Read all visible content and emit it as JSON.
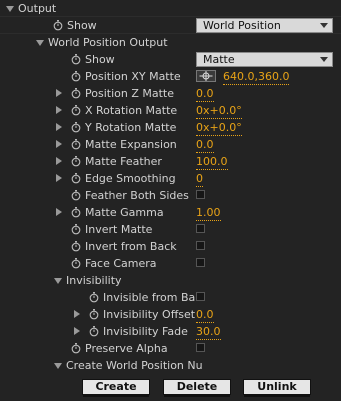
{
  "rows": [
    {
      "label": "Output",
      "tw": "open",
      "indent": 6,
      "sep": true
    },
    {
      "label": "Show",
      "sw": true,
      "indent": 52,
      "control": {
        "type": "dropdown",
        "value": "World Position"
      },
      "sep": true
    },
    {
      "label": "World Position Output",
      "tw": "open",
      "indent": 36
    },
    {
      "label": "Show",
      "sw": true,
      "indent": 70,
      "control": {
        "type": "dropdown",
        "value": "Matte"
      }
    },
    {
      "label": "Position XY Matte",
      "sw": true,
      "indent": 70,
      "control": {
        "type": "target",
        "value": "640.0,360.0"
      }
    },
    {
      "label": "Position Z Matte",
      "sw": true,
      "tw": "closed",
      "indent": 56,
      "control": {
        "type": "value",
        "value": "0.0"
      }
    },
    {
      "label": "X Rotation Matte",
      "sw": true,
      "tw": "closed",
      "indent": 56,
      "control": {
        "type": "value",
        "value": "0x+0.0°"
      }
    },
    {
      "label": "Y Rotation Matte",
      "sw": true,
      "tw": "closed",
      "indent": 56,
      "control": {
        "type": "value",
        "value": "0x+0.0°"
      }
    },
    {
      "label": "Matte Expansion",
      "sw": true,
      "tw": "closed",
      "indent": 56,
      "control": {
        "type": "value",
        "value": "0.0"
      }
    },
    {
      "label": "Matte Feather",
      "sw": true,
      "tw": "closed",
      "indent": 56,
      "control": {
        "type": "value",
        "value": "100.0"
      }
    },
    {
      "label": "Edge Smoothing",
      "sw": true,
      "tw": "closed",
      "indent": 56,
      "control": {
        "type": "value",
        "value": "0"
      }
    },
    {
      "label": "Feather Both Sides",
      "sw": true,
      "indent": 70,
      "control": {
        "type": "checkbox"
      }
    },
    {
      "label": "Matte Gamma",
      "sw": true,
      "tw": "closed",
      "indent": 56,
      "control": {
        "type": "value",
        "value": "1.00"
      }
    },
    {
      "label": "Invert Matte",
      "sw": true,
      "indent": 70,
      "control": {
        "type": "checkbox"
      }
    },
    {
      "label": "Invert from Back",
      "sw": true,
      "indent": 70,
      "control": {
        "type": "checkbox"
      }
    },
    {
      "label": "Face Camera",
      "sw": true,
      "indent": 70,
      "control": {
        "type": "checkbox"
      }
    },
    {
      "label": "Invisibility",
      "tw": "open",
      "indent": 54
    },
    {
      "label": "Invisible from Bac",
      "sw": true,
      "indent": 88,
      "control": {
        "type": "checkbox"
      }
    },
    {
      "label": "Invisibility Offset",
      "sw": true,
      "tw": "closed",
      "indent": 74,
      "control": {
        "type": "value",
        "value": "0.0"
      }
    },
    {
      "label": "Invisibility Fade",
      "sw": true,
      "tw": "closed",
      "indent": 74,
      "control": {
        "type": "value",
        "value": "30.0"
      }
    },
    {
      "label": "Preserve Alpha",
      "sw": true,
      "indent": 70,
      "control": {
        "type": "checkbox"
      }
    },
    {
      "label": "Create World Position Nu",
      "tw": "open",
      "indent": 54
    }
  ],
  "buttons": {
    "create": "Create",
    "delete": "Delete",
    "unlink": "Unlink"
  },
  "colors": {
    "background": "#232323",
    "value": "#e8a317",
    "label": "#d2d2d2"
  }
}
